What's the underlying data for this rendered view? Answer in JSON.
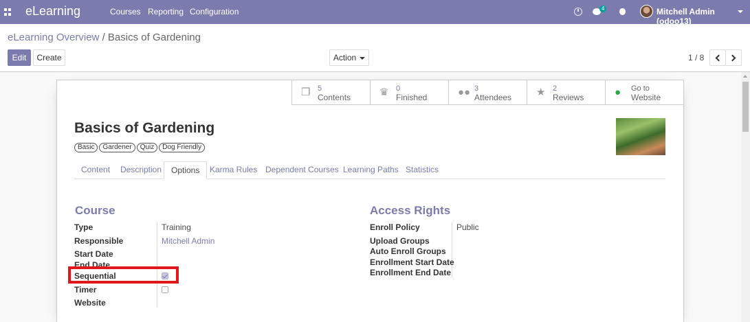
{
  "navbar": {
    "brand": "eLearning",
    "menu": [
      "Courses",
      "Reporting",
      "Configuration"
    ],
    "message_count": "4",
    "user": "Mitchell Admin (odoo13)",
    "icons": [
      "apps-icon",
      "clock-icon",
      "chat-icon",
      "bug-icon"
    ]
  },
  "breadcrumb": {
    "parent": "eLearning Overview",
    "separator": "/",
    "current": "Basics of Gardening"
  },
  "buttons": {
    "edit": "Edit",
    "create": "Create",
    "action": "Action"
  },
  "pager": {
    "value": "1 / 8"
  },
  "stats": [
    {
      "value": "5",
      "label": "Contents",
      "icon": "contents-icon"
    },
    {
      "value": "0",
      "label": "Finished",
      "icon": "trophy-icon"
    },
    {
      "value": "3",
      "label": "Attendees",
      "icon": "users-icon"
    },
    {
      "value": "2",
      "label": "Reviews",
      "icon": "star-icon"
    },
    {
      "value": "Go to",
      "label": "Website",
      "icon": "globe-icon"
    }
  ],
  "course": {
    "title": "Basics of Gardening",
    "tags": [
      "Basic",
      "Gardener",
      "Quiz",
      "Dog Friendly"
    ]
  },
  "tabs": [
    "Content",
    "Description",
    "Options",
    "Karma Rules",
    "Dependent Courses",
    "Learning Paths",
    "Statistics"
  ],
  "active_tab": "Options",
  "course_group": {
    "title": "Course",
    "fields": [
      {
        "label": "Type",
        "value": "Training"
      },
      {
        "label": "Responsible",
        "value": "Mitchell Admin"
      },
      {
        "label": "Start Date",
        "value": ""
      },
      {
        "label": "End Date",
        "value": ""
      },
      {
        "label": "Sequential",
        "checked": true
      },
      {
        "label": "Timer",
        "checked": false
      },
      {
        "label": "Website",
        "value": ""
      }
    ]
  },
  "access_group": {
    "title": "Access Rights",
    "fields": [
      {
        "label": "Enroll Policy",
        "value": "Public"
      },
      {
        "label": "Upload Groups",
        "value": ""
      },
      {
        "label": "Auto Enroll Groups",
        "value": ""
      },
      {
        "label": "Enrollment Start Date",
        "value": ""
      },
      {
        "label": "Enrollment End Date",
        "value": ""
      }
    ]
  },
  "colors": {
    "brand": "#7c7bad",
    "highlight": "#e2171c",
    "badge": "#00a09d"
  }
}
